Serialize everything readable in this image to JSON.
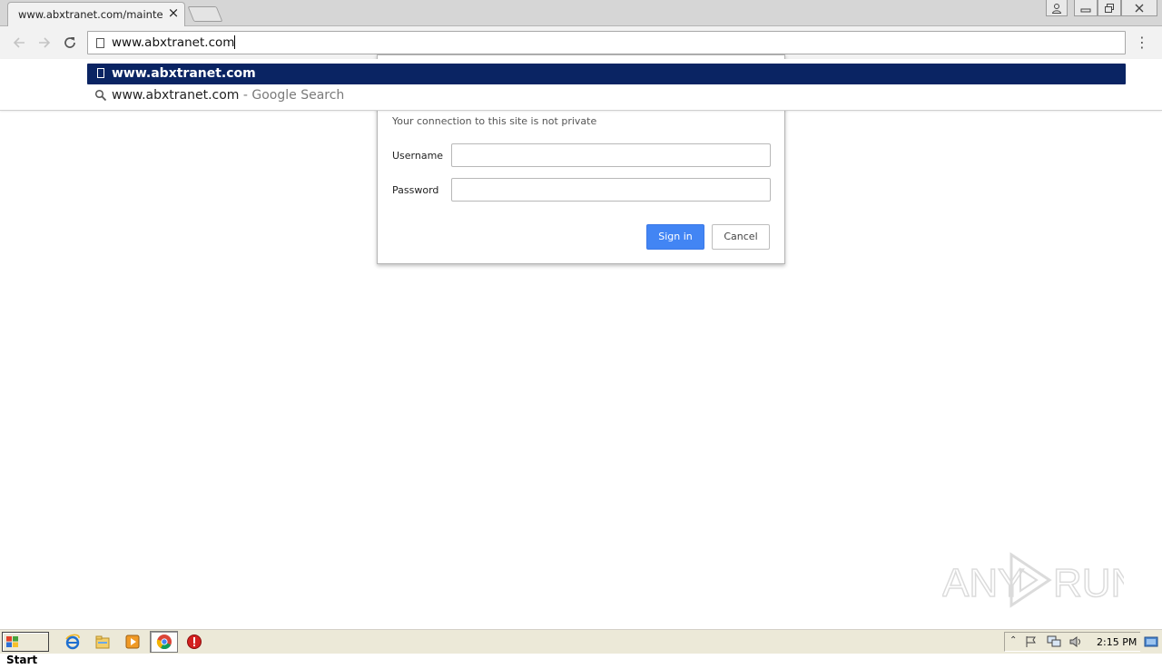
{
  "browser": {
    "tab": {
      "title": "www.abxtranet.com/maintenanc",
      "close_glyph": "×"
    },
    "address_bar": {
      "value": "www.abxtranet.com"
    },
    "menu_glyph": "⋮"
  },
  "omnibox_dropdown": {
    "items": [
      {
        "text": "www.abxtranet.com",
        "hint": "",
        "icon": "page-icon",
        "selected": true
      },
      {
        "text": "www.abxtranet.com",
        "hint": " - Google Search",
        "icon": "search-icon",
        "selected": false
      }
    ]
  },
  "auth_dialog": {
    "message": "Your connection to this site is not private",
    "username_label": "Username",
    "username_value": "",
    "password_label": "Password",
    "password_value": "",
    "sign_in_label": "Sign in",
    "cancel_label": "Cancel"
  },
  "watermark": {
    "text_left": "ANY",
    "text_right": "RUN"
  },
  "taskbar": {
    "start_label": "Start",
    "clock": "2:15 PM",
    "pinned": [
      "ie-icon",
      "explorer-icon",
      "media-player-icon",
      "chrome-icon",
      "stop-icon"
    ]
  },
  "colors": {
    "selection": "#0a2463",
    "primary_button": "#4285f4",
    "taskbar": "#ece9d8"
  }
}
